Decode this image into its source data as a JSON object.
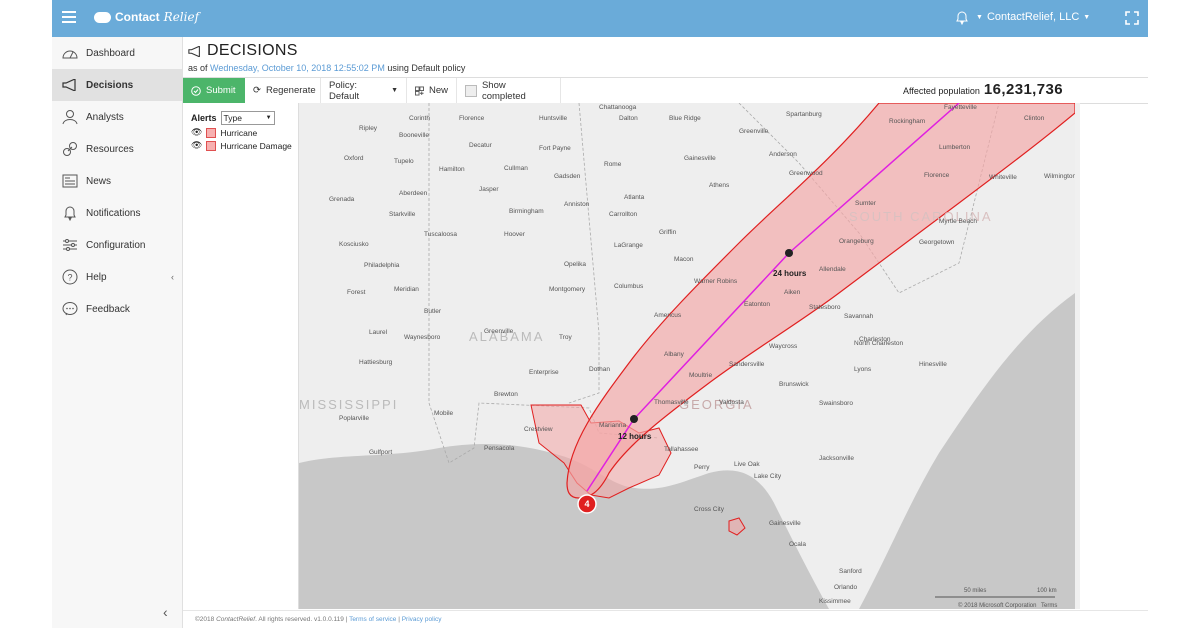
{
  "app": {
    "logo_contact": "Contact",
    "logo_relief": "Relief",
    "user": "ContactRelief, LLC"
  },
  "sidebar": {
    "items": [
      {
        "label": "Dashboard",
        "icon": "dashboard-icon"
      },
      {
        "label": "Decisions",
        "icon": "megaphone-icon",
        "active": true
      },
      {
        "label": "Analysts",
        "icon": "person-icon"
      },
      {
        "label": "Resources",
        "icon": "link-icon"
      },
      {
        "label": "News",
        "icon": "news-icon"
      },
      {
        "label": "Notifications",
        "icon": "bell-icon"
      },
      {
        "label": "Configuration",
        "icon": "sliders-icon"
      },
      {
        "label": "Help",
        "icon": "help-icon"
      },
      {
        "label": "Feedback",
        "icon": "chat-icon"
      }
    ],
    "help_chevron": "‹",
    "collapse": "‹"
  },
  "page": {
    "title": "DECISIONS",
    "as_of": "as of",
    "date": "Wednesday, October 10, 2018 12:55:02 PM",
    "policy_text": "using Default policy"
  },
  "toolbar": {
    "submit": "Submit",
    "regenerate": "Regenerate",
    "policy": "Policy: Default",
    "new": "New",
    "show_completed": "Show completed"
  },
  "affected": {
    "label": "Affected population",
    "value": "16,231,736"
  },
  "alerts": {
    "label": "Alerts",
    "type": "Type",
    "items": [
      "Hurricane",
      "Hurricane Damage"
    ]
  },
  "map": {
    "state_labels": [
      "ALABAMA",
      "GEORGIA",
      "SOUTH CAROLINA",
      "MISSISSIPPI"
    ],
    "cities": [
      "Chattanooga",
      "Florence",
      "Huntsville",
      "Dalton",
      "Ripley",
      "Corinth",
      "Booneville",
      "Blue Ridge",
      "Decatur",
      "Fort Payne",
      "Oxford",
      "Tupelo",
      "Cullman",
      "Gadsden",
      "Rome",
      "Gainesville",
      "Hamilton",
      "Jasper",
      "Aberdeen",
      "Grenada",
      "Anniston",
      "Carrollton",
      "Atlanta",
      "Athens",
      "Starkville",
      "Birmingham",
      "Hoover",
      "Griffin",
      "Kosciusko",
      "Tuscaloosa",
      "LaGrange",
      "Philadelphia",
      "Opelika",
      "Macon",
      "Meridian",
      "Forest",
      "Montgomery",
      "Columbus",
      "Warner Robins",
      "Butler",
      "Americus",
      "Laurel",
      "Waynesboro",
      "Greenville",
      "Troy",
      "Albany",
      "Hattiesburg",
      "Dothan",
      "Enterprise",
      "Brewton",
      "Moultrie",
      "Thomasville",
      "Valdosta",
      "Mobile",
      "Marianna",
      "Tallahassee",
      "Poplarville",
      "Crestview",
      "Pensacola",
      "Gulfport",
      "Perry",
      "Live Oak",
      "Lake City",
      "Jacksonville",
      "Cross City",
      "Gainesville",
      "Ocala",
      "Sanford",
      "Orlando",
      "Kissimmee",
      "Greenville",
      "Spartanburg",
      "Anderson",
      "Greenwood",
      "Fayetteville",
      "Rockingham",
      "Lumberton",
      "Clinton",
      "Florence",
      "Whiteville",
      "Wilmington",
      "Sumter",
      "Myrtle Beach",
      "Georgetown",
      "Orangeburg",
      "Aiken",
      "Allendale",
      "Statesboro",
      "Savannah",
      "North Charleston",
      "Charleston",
      "Hinesville",
      "Lyons",
      "Waycross",
      "Brunswick",
      "Swainsboro",
      "Sandersville",
      "Eatonton"
    ],
    "labels_12": "12 hours",
    "labels_24": "24 hours",
    "marker": "4",
    "scale_50": "50 miles",
    "scale_100": "100 km",
    "copyright": "© 2018 Microsoft Corporation",
    "terms": "Terms"
  },
  "footer": {
    "copyright": "©2018",
    "brand": "ContactRelief",
    "rights": ". All rights reserved. v1.0.0.119 |",
    "terms": "Terms of service",
    "sep": "|",
    "privacy": "Privacy policy"
  },
  "colors": {
    "topbar": "#6aabd9",
    "submit": "#4cb56a",
    "hurricane_fill": "#f4a6a6",
    "hurricane_line": "#e02020",
    "track": "#e020e0"
  }
}
